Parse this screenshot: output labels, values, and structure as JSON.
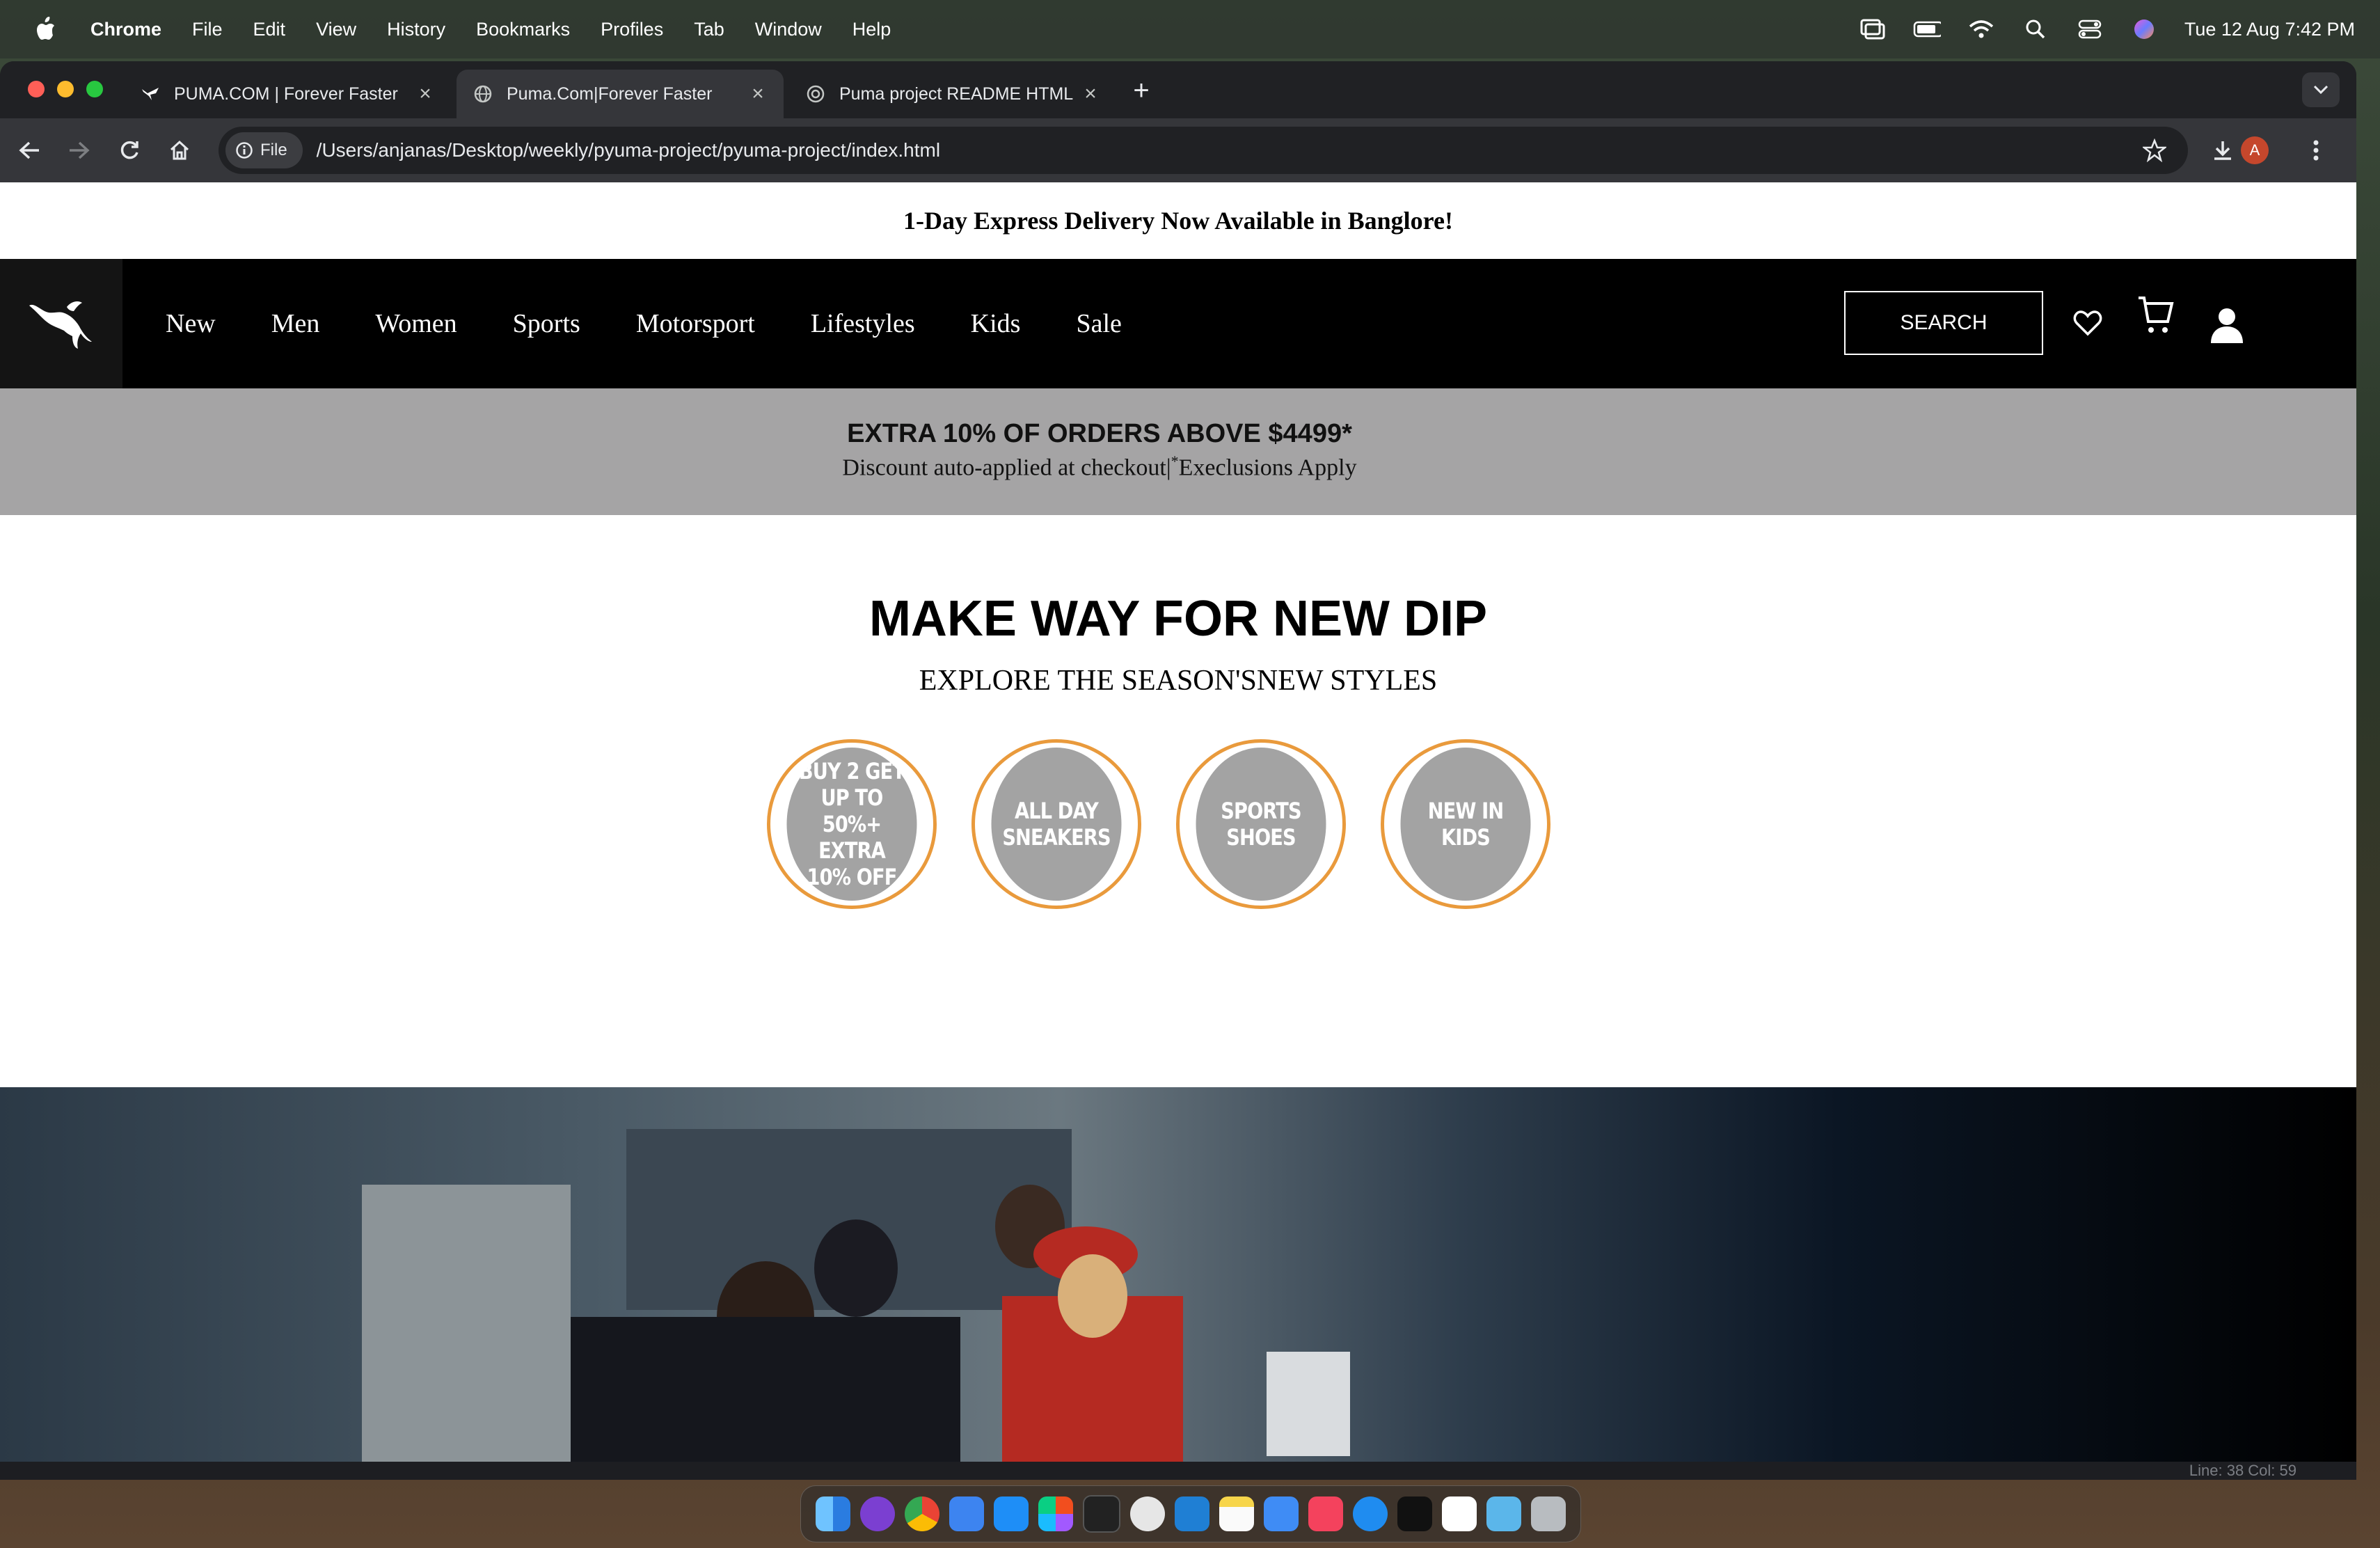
{
  "menubar": {
    "app": "Chrome",
    "items": [
      "File",
      "Edit",
      "View",
      "History",
      "Bookmarks",
      "Profiles",
      "Tab",
      "Window",
      "Help"
    ],
    "clock": "Tue 12 Aug  7:42 PM"
  },
  "tabs": [
    {
      "title": "PUMA.COM | Forever Faster",
      "active": false
    },
    {
      "title": "Puma.Com|Forever Faster",
      "active": true
    },
    {
      "title": "Puma project README HTML",
      "active": false
    }
  ],
  "toolbar": {
    "chip": "File",
    "url": "/Users/anjanas/Desktop/weekly/pyuma-project/pyuma-project/index.html",
    "profile_initial": "A"
  },
  "page": {
    "announcement": "1-Day Express Delivery Now Available in Banglore!",
    "nav": [
      "New",
      "Men",
      "Women",
      "Sports",
      "Motorsport",
      "Lifestyles",
      "Kids",
      "Sale"
    ],
    "search_label": "SEARCH",
    "promo": {
      "headline": "EXTRA 10% OF ORDERS ABOVE $4499*",
      "sub_before": "Discount auto-applied at checkout|",
      "sub_sup": "*",
      "sub_after": "Execlusions Apply"
    },
    "hero_title": "MAKE WAY FOR NEW DIP",
    "hero_subtitle": "EXPLORE THE SEASON'SNEW STYLES",
    "categories": [
      "BUY 2 GET UP TO 50%+ EXTRA 10% OFF",
      "ALL DAY SNEAKERS",
      "SPORTS SHOES",
      "NEW IN KIDS"
    ]
  },
  "editor_status": "Line: 38  Col: 59",
  "colors": {
    "promo_bg": "#a5a4a5",
    "circle_border": "#e99a3c",
    "circle_fill": "#a3a3a3",
    "nav_bg": "#000000"
  }
}
